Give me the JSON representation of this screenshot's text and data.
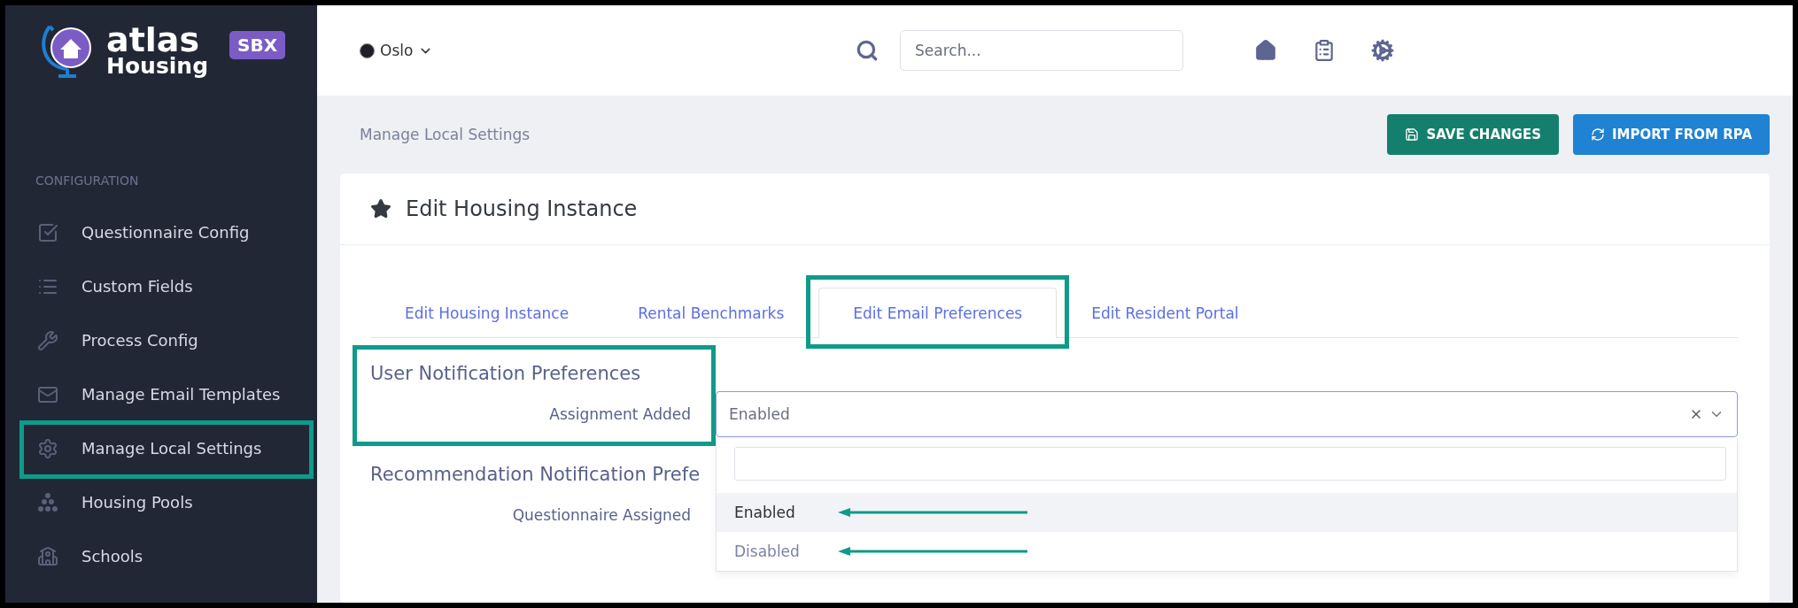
{
  "logo": {
    "name": "atlas",
    "sub": "Housing",
    "badge": "SBX"
  },
  "sidebar": {
    "section": "CONFIGURATION",
    "items": [
      {
        "label": "Questionnaire Config",
        "highlighted": false
      },
      {
        "label": "Custom Fields",
        "highlighted": false
      },
      {
        "label": "Process Config",
        "highlighted": false
      },
      {
        "label": "Manage Email Templates",
        "highlighted": false
      },
      {
        "label": "Manage Local Settings",
        "highlighted": true
      },
      {
        "label": "Housing Pools",
        "highlighted": false
      },
      {
        "label": "Schools",
        "highlighted": false
      }
    ]
  },
  "header": {
    "location": "Oslo",
    "search": {
      "placeholder": "Search..."
    }
  },
  "breadcrumb": "Manage Local Settings",
  "actions": [
    {
      "label": "SAVE CHANGES",
      "kind": "save"
    },
    {
      "label": "IMPORT FROM RPA",
      "kind": "import"
    }
  ],
  "card": {
    "title": "Edit Housing Instance",
    "tabs": [
      {
        "label": "Edit Housing Instance",
        "selected": false,
        "highlighted": false
      },
      {
        "label": "Rental Benchmarks",
        "selected": false,
        "highlighted": false
      },
      {
        "label": "Edit Email Preferences",
        "selected": true,
        "highlighted": true
      },
      {
        "label": "Edit Resident Portal",
        "selected": false,
        "highlighted": false
      }
    ],
    "sections": [
      {
        "title": "User Notification Preferences",
        "highlighted": true,
        "fields": [
          {
            "label": "Assignment Added",
            "value": "Enabled",
            "open": true,
            "options": [
              {
                "label": "Enabled",
                "selected": true,
                "arrow": true
              },
              {
                "label": "Disabled",
                "selected": false,
                "arrow": true
              }
            ]
          }
        ]
      },
      {
        "title": "Recommendation Notification Prefe",
        "highlighted": false,
        "fields": [
          {
            "label": "Questionnaire Assigned"
          }
        ]
      }
    ]
  }
}
